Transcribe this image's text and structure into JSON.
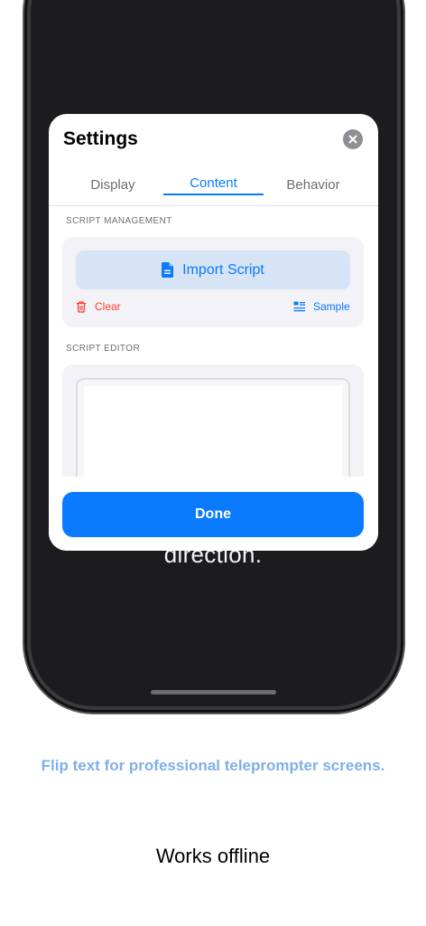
{
  "background_text": "direction.",
  "settings": {
    "title": "Settings",
    "tabs": [
      {
        "label": "Display",
        "active": false
      },
      {
        "label": "Content",
        "active": true
      },
      {
        "label": "Behavior",
        "active": false
      }
    ],
    "script_management": {
      "section_label": "SCRIPT MANAGEMENT",
      "import_label": "Import Script",
      "clear_label": "Clear",
      "sample_label": "Sample"
    },
    "script_editor": {
      "section_label": "SCRIPT EDITOR"
    },
    "done_label": "Done"
  },
  "marketing": {
    "tagline": "Flip text for professional teleprompter screens.",
    "feature": "Works offline"
  },
  "icons": {
    "close": "close-icon",
    "document": "document-icon",
    "trash": "trash-icon",
    "sample": "sample-icon"
  },
  "colors": {
    "accent": "#0a7aff",
    "destructive": "#ff3b30",
    "tagline": "#7fb0e6",
    "phone_bg": "#1c1c1e"
  }
}
